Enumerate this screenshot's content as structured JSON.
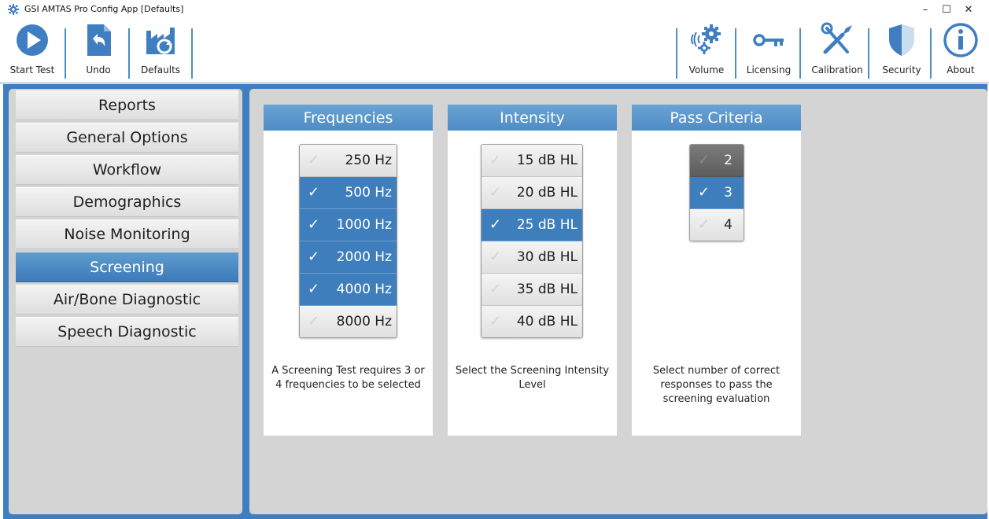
{
  "window": {
    "title": "GSI AMTAS Pro Config App [Defaults]",
    "minimize": "–",
    "maximize": "☐",
    "close": "✕"
  },
  "toolbar": {
    "left": [
      {
        "label": "Start Test",
        "icon": "play-icon"
      },
      {
        "label": "Undo",
        "icon": "undo-icon"
      },
      {
        "label": "Defaults",
        "icon": "factory-reset-icon"
      }
    ],
    "right": [
      {
        "label": "Volume",
        "icon": "volume-gear-icon"
      },
      {
        "label": "Licensing",
        "icon": "key-icon"
      },
      {
        "label": "Calibration",
        "icon": "tools-icon"
      },
      {
        "label": "Security",
        "icon": "shield-icon"
      },
      {
        "label": "About",
        "icon": "info-icon"
      }
    ]
  },
  "sidebar": {
    "items": [
      {
        "label": "Reports",
        "active": false
      },
      {
        "label": "General Options",
        "active": false
      },
      {
        "label": "Workflow",
        "active": false
      },
      {
        "label": "Demographics",
        "active": false
      },
      {
        "label": "Noise Monitoring",
        "active": false
      },
      {
        "label": "Screening",
        "active": true
      },
      {
        "label": "Air/Bone Diagnostic",
        "active": false
      },
      {
        "label": "Speech Diagnostic",
        "active": false
      }
    ]
  },
  "frequencies": {
    "title": "Frequencies",
    "options": [
      {
        "label": "250 Hz",
        "selected": false
      },
      {
        "label": "500 Hz",
        "selected": true
      },
      {
        "label": "1000 Hz",
        "selected": true
      },
      {
        "label": "2000 Hz",
        "selected": true
      },
      {
        "label": "4000 Hz",
        "selected": true
      },
      {
        "label": "8000 Hz",
        "selected": false
      }
    ],
    "description": "A Screening Test requires 3 or 4 frequencies to be selected"
  },
  "intensity": {
    "title": "Intensity",
    "options": [
      {
        "label": "15 dB HL",
        "selected": false
      },
      {
        "label": "20 dB HL",
        "selected": false
      },
      {
        "label": "25 dB HL",
        "selected": true
      },
      {
        "label": "30 dB HL",
        "selected": false
      },
      {
        "label": "35 dB HL",
        "selected": false
      },
      {
        "label": "40 dB HL",
        "selected": false
      }
    ],
    "description": "Select the Screening Intensity Level"
  },
  "pass_criteria": {
    "title": "Pass Criteria",
    "options": [
      {
        "label": "2",
        "selected": false,
        "disabled": true
      },
      {
        "label": "3",
        "selected": true
      },
      {
        "label": "4",
        "selected": false
      }
    ],
    "description": "Select number of correct responses to pass the screening evaluation"
  },
  "checkmark": "✓",
  "colors": {
    "accent": "#3f7ebd",
    "frame": "#3f7fc1",
    "panel": "#d4d4d4",
    "header": "#5a95cb"
  }
}
